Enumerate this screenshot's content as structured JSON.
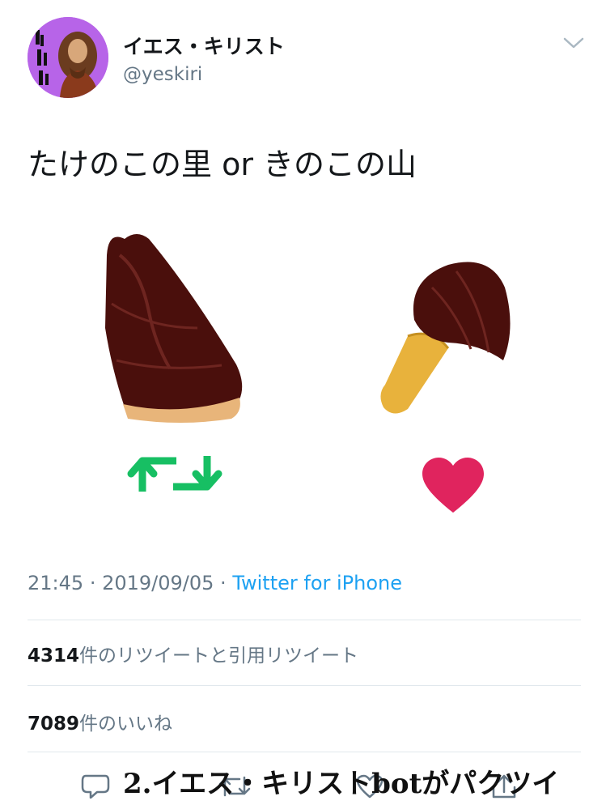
{
  "tweet": {
    "display_name": "イエス・キリスト",
    "handle": "@yeskiri",
    "text": "たけのこの里 or きのこの山",
    "time": "21:45",
    "date": "2019/09/05",
    "source": "Twitter for iPhone",
    "retweets_count": "4314",
    "retweets_label": "件のリツイートと引用リツイート",
    "likes_count": "7089",
    "likes_label": "件のいいね"
  },
  "caption": "2.イエス・キリストbotがパクツイ",
  "icons": [
    "chevron-down-icon",
    "retweet-icon",
    "heart-icon",
    "reply-icon",
    "retweet-action-icon",
    "like-action-icon",
    "share-icon"
  ],
  "colors": {
    "accent": "#1da1f2",
    "retweet": "#17bf63",
    "heart": "#e0245e",
    "muted": "#657786",
    "avatar_bg": "#b764e8"
  }
}
